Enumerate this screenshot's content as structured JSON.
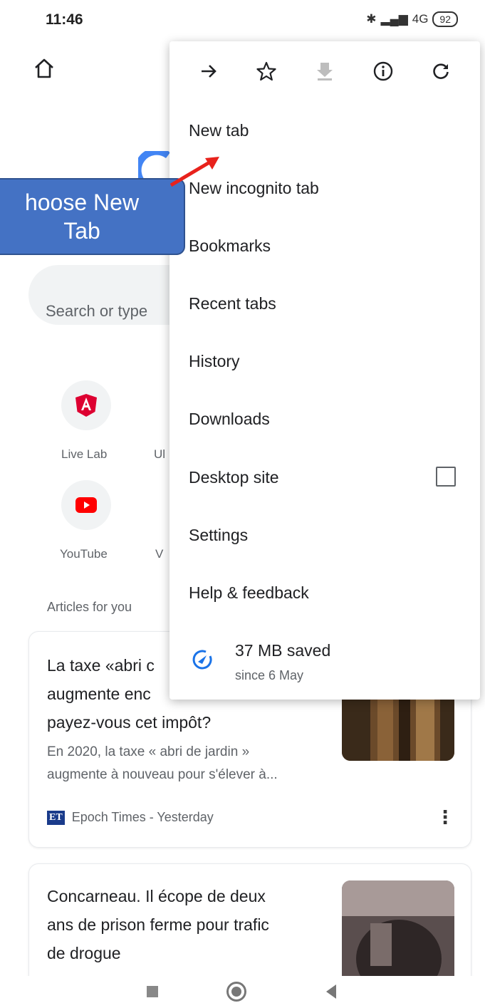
{
  "status_bar": {
    "time": "11:46",
    "network": "4G",
    "battery": "92"
  },
  "search": {
    "placeholder": "Search or type"
  },
  "tiles": [
    {
      "label": "Live Lab",
      "icon": "angular-icon"
    },
    {
      "label": "Ul",
      "icon": ""
    },
    {
      "label": "YouTube",
      "icon": "youtube-icon"
    },
    {
      "label": "V",
      "icon": ""
    }
  ],
  "articles_label": "Articles for you",
  "articles": [
    {
      "title_lines": [
        "La taxe «abri c",
        "augmente enc",
        "payez-vous cet impôt?"
      ],
      "snippet_lines": [
        "En 2020, la taxe « abri de jardin »",
        "augmente à nouveau pour s'élever à..."
      ],
      "source_logo": "ET",
      "source": "Epoch Times - Yesterday"
    },
    {
      "title_lines": [
        "Concarneau. Il écope de deux",
        "ans de prison ferme pour trafic",
        "de drogue"
      ]
    }
  ],
  "menu": {
    "toolbar": [
      "forward-icon",
      "star-icon",
      "download-icon",
      "info-icon",
      "refresh-icon"
    ],
    "items": [
      "New tab",
      "New incognito tab",
      "Bookmarks",
      "Recent tabs",
      "History",
      "Downloads",
      "Desktop site",
      "Settings",
      "Help & feedback"
    ],
    "data_saved": {
      "title": "37 MB saved",
      "subtitle": "since 6 May"
    }
  },
  "callout": {
    "line1": "hoose New",
    "line2": "Tab"
  },
  "colors": {
    "callout": "#4472c4",
    "arrow": "#e8221c",
    "google_blue": "#4285f4",
    "youtube_red": "#ff0000",
    "angular_red": "#dd0031"
  }
}
